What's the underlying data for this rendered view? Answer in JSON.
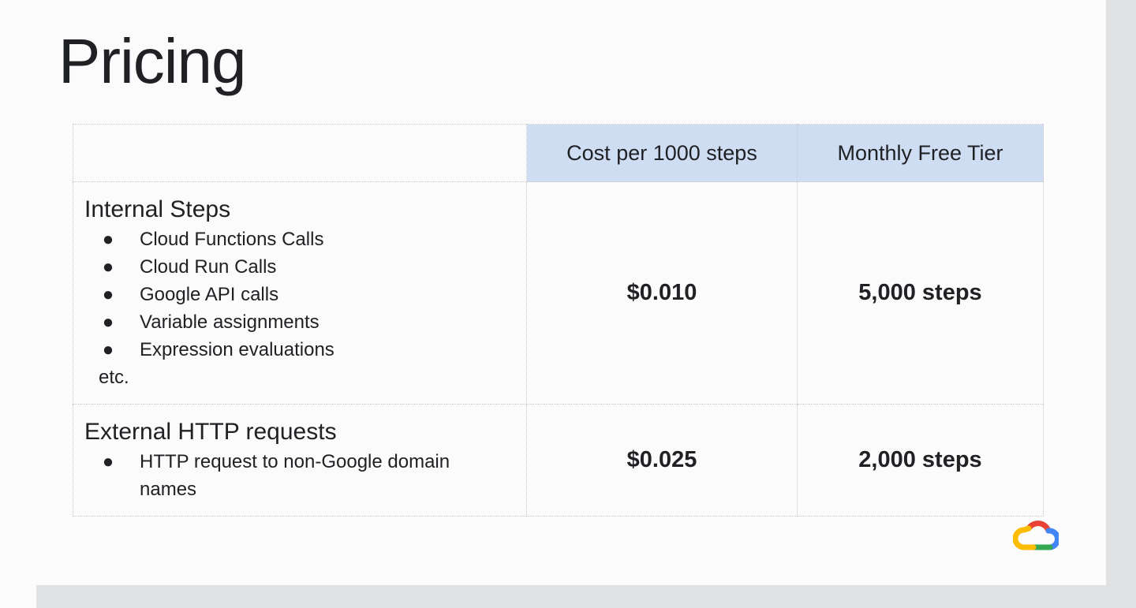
{
  "slide": {
    "title": "Pricing"
  },
  "table": {
    "headers": [
      "",
      "Cost per 1000 steps",
      "Monthly Free Tier"
    ],
    "rows": [
      {
        "label": "Internal Steps",
        "items": [
          "Cloud Functions Calls",
          "Cloud Run Calls",
          "Google API calls",
          "Variable assignments",
          "Expression evaluations"
        ],
        "footnote": "etc.",
        "cost": "$0.010",
        "free_tier": "5,000 steps"
      },
      {
        "label": "External HTTP requests",
        "items": [
          "HTTP request to non-Google domain names"
        ],
        "cost": "$0.025",
        "free_tier": "2,000 steps"
      }
    ]
  },
  "bullet_glyph": "●",
  "logo": {
    "icon": "google-cloud-logo",
    "colors": [
      "#ea4335",
      "#fbbc04",
      "#34a853",
      "#4285f4"
    ]
  },
  "colors": {
    "header_fill": "#cfddf3",
    "slide_bg": "#fbfbfb",
    "frame_bg": "#dfe1e3"
  }
}
